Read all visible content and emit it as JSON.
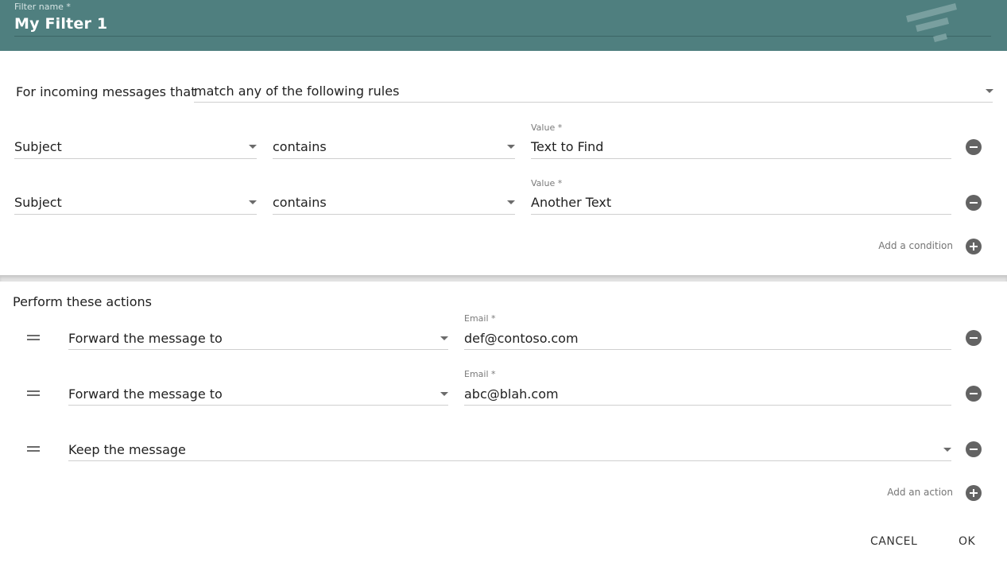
{
  "header": {
    "filter_name_label": "Filter name *",
    "filter_name_value": "My Filter 1",
    "background_color": "#4f7f7f",
    "logo_icon": "filter-lines-icon"
  },
  "match": {
    "prefix_label": "For incoming messages that",
    "selected": "match any of the following rules"
  },
  "conditions": [
    {
      "field": "Subject",
      "operator": "contains",
      "value_label": "Value *",
      "value": "Text to Find"
    },
    {
      "field": "Subject",
      "operator": "contains",
      "value_label": "Value *",
      "value": "Another Text"
    }
  ],
  "add_condition_label": "Add a condition",
  "actions_title": "Perform these actions",
  "actions": [
    {
      "action": "Forward the message to",
      "value_label": "Email *",
      "value": "def@contoso.com"
    },
    {
      "action": "Forward the message to",
      "value_label": "Email *",
      "value": "abc@blah.com"
    },
    {
      "action": "Keep the message"
    }
  ],
  "add_action_label": "Add an action",
  "footer": {
    "cancel_label": "CANCEL",
    "ok_label": "OK"
  }
}
